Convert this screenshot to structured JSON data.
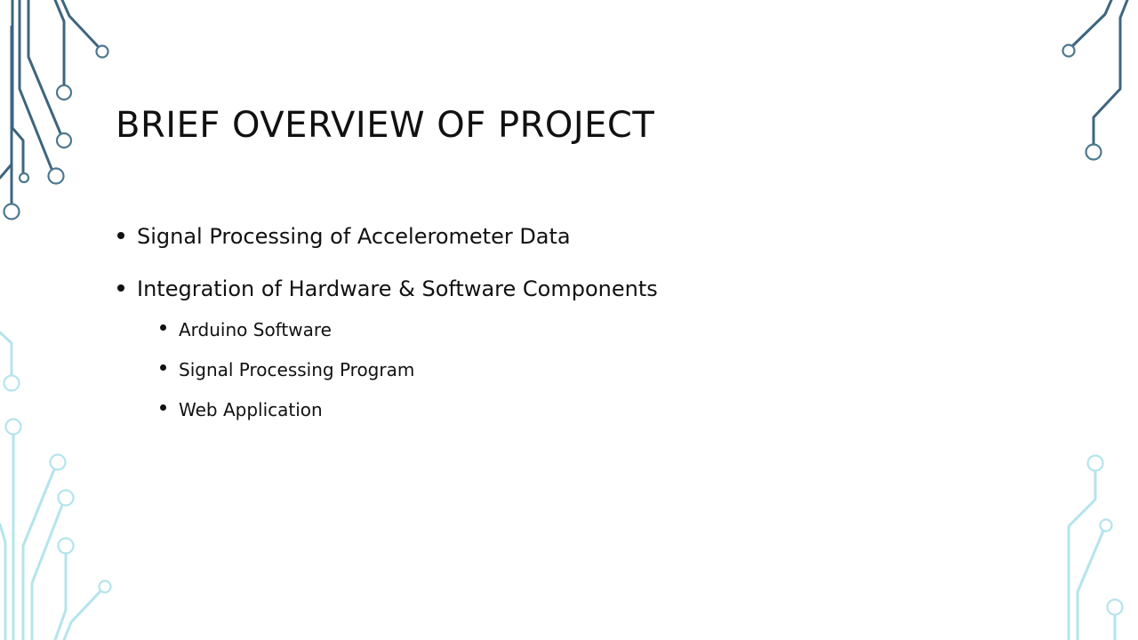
{
  "slide": {
    "title": "BRIEF OVERVIEW OF PROJECT",
    "bullets": [
      {
        "text": "Signal Processing of Accelerometer Data",
        "sub_items": []
      },
      {
        "text": "Integration of Hardware & Software Components",
        "sub_items": [
          {
            "text": "Arduino Software"
          },
          {
            "text": "Signal Processing Program"
          },
          {
            "text": "Web Application"
          }
        ]
      }
    ]
  },
  "theme": {
    "circuit_dark_color": "#3e6580",
    "circuit_light_color": "#b4e4ec",
    "background_color": "#ffffff",
    "text_color": "#111111"
  }
}
